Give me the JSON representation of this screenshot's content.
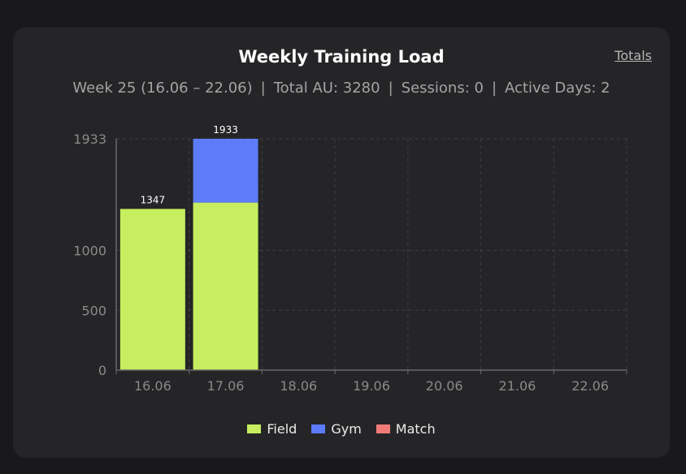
{
  "card": {
    "title": "Weekly Training Load",
    "totals_link": "Totals",
    "summary": {
      "week": "Week 25 (16.06 – 22.06)",
      "total_au": "Total AU: 3280",
      "sessions": "Sessions: 0",
      "active_days": "Active Days: 2",
      "separator": "|"
    }
  },
  "colors": {
    "field": "#c6ee5e",
    "gym": "#5c7cfa",
    "match": "#f07b76",
    "grid": "#3e3e40",
    "axis": "#6a6a6c"
  },
  "chart_data": {
    "type": "bar",
    "stacked": true,
    "categories": [
      "16.06",
      "17.06",
      "18.06",
      "19.06",
      "20.06",
      "21.06",
      "22.06"
    ],
    "series": [
      {
        "name": "Field",
        "values": [
          1347,
          1400,
          0,
          0,
          0,
          0,
          0
        ]
      },
      {
        "name": "Gym",
        "values": [
          0,
          533,
          0,
          0,
          0,
          0,
          0
        ]
      },
      {
        "name": "Match",
        "values": [
          0,
          0,
          0,
          0,
          0,
          0,
          0
        ]
      }
    ],
    "totals": [
      1347,
      1933,
      null,
      null,
      null,
      null,
      null
    ],
    "yticks": [
      0,
      500,
      1000,
      1933
    ],
    "ylim": [
      0,
      1933
    ],
    "grid": true,
    "legend_position": "bottom"
  }
}
